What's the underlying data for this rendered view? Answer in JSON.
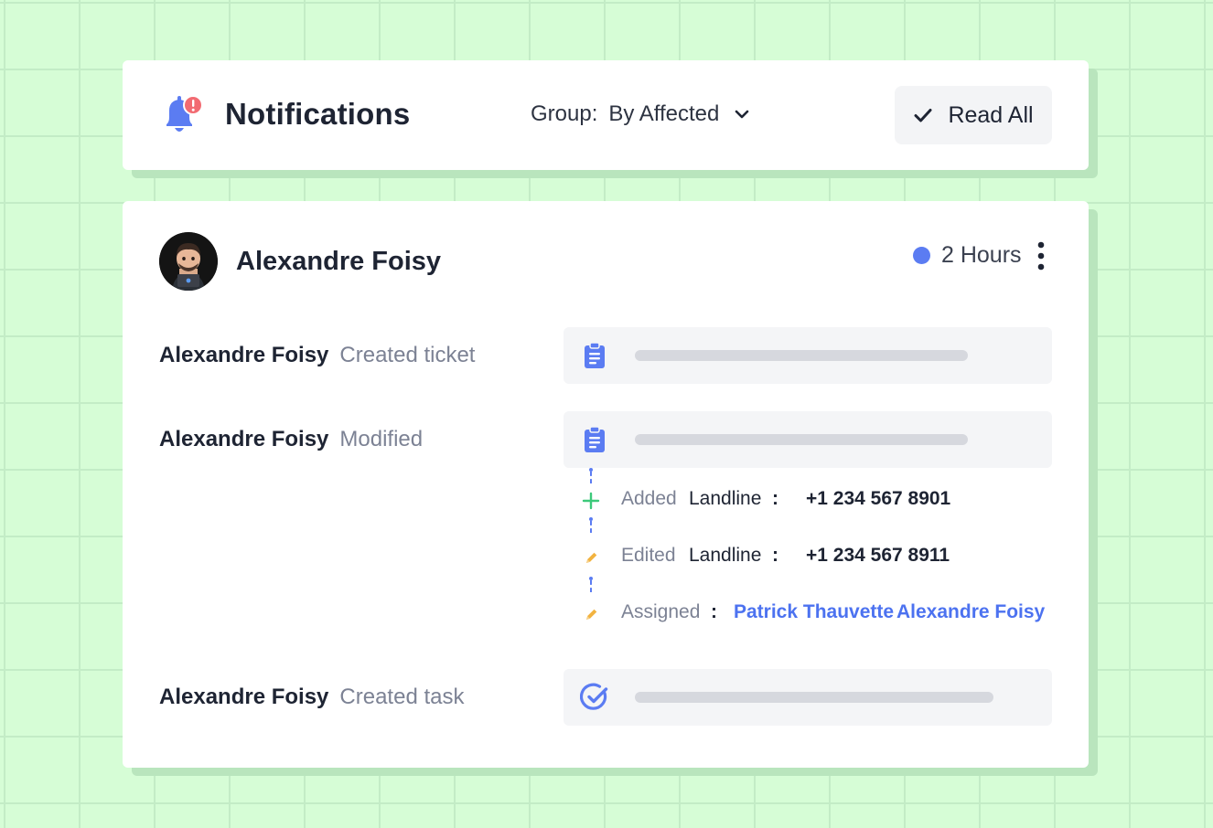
{
  "header": {
    "title": "Notifications",
    "group_label": "Group:",
    "group_value": "By Affected",
    "read_all_label": "Read All"
  },
  "notification": {
    "user_name": "Alexandre Foisy",
    "time_label": "2 Hours",
    "activities": [
      {
        "user": "Alexandre Foisy",
        "action": "Created ticket",
        "icon": "clipboard-icon"
      },
      {
        "user": "Alexandre Foisy",
        "action": "Modified",
        "icon": "clipboard-icon"
      },
      {
        "user": "Alexandre Foisy",
        "action": "Created task",
        "icon": "check-circle-icon"
      }
    ],
    "changes": [
      {
        "icon": "plus-icon",
        "verb": "Added",
        "field": "Landline",
        "colon": ":",
        "value": "+1 234 567 8901"
      },
      {
        "icon": "pencil-icon",
        "verb": "Edited",
        "field": "Landline",
        "colon": ":",
        "value": "+1 234 567 8911"
      },
      {
        "icon": "pencil-icon",
        "verb": "Assigned",
        "colon": ":",
        "links": [
          "Patrick Thauvette",
          "Alexandre Foisy"
        ]
      }
    ]
  },
  "colors": {
    "background": "#d6fdd6",
    "accent": "#5b7cf2",
    "link": "#4c72f0",
    "added": "#3cc97a",
    "edited": "#f2b340",
    "alert": "#f26b72"
  }
}
